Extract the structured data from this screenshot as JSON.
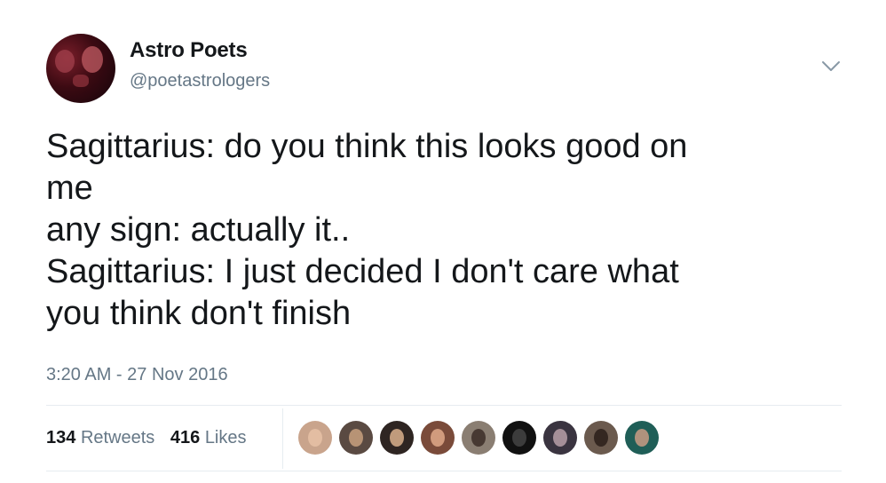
{
  "author": {
    "name": "Astro Poets",
    "handle": "@poetastrologers",
    "avatar_icon": "profile-photo-avatar"
  },
  "menu_icon": "chevron-down-icon",
  "tweet": {
    "lines": [
      "Sagittarius: do you think this looks good on",
      "me",
      "any sign: actually it..",
      "Sagittarius: I just decided I don't care what",
      "you think don't finish"
    ],
    "timestamp": "3:20 AM - 27 Nov 2016"
  },
  "stats": {
    "retweets_count": "134",
    "retweets_label": "Retweets",
    "likes_count": "416",
    "likes_label": "Likes"
  },
  "likers": [
    {
      "bg": "#c9a48c",
      "face": "#e8c2a6"
    },
    {
      "bg": "#5a4a42",
      "face": "#c8a07e"
    },
    {
      "bg": "#2e2522",
      "face": "#d9b08c"
    },
    {
      "bg": "#7a4b3a",
      "face": "#e0a989"
    },
    {
      "bg": "#8a7e72",
      "face": "#3b2d27"
    },
    {
      "bg": "#111111",
      "face": "#444444"
    },
    {
      "bg": "#3a3440",
      "face": "#b9a0a8"
    },
    {
      "bg": "#6b5a4e",
      "face": "#2a1e1a"
    },
    {
      "bg": "#1f5e57",
      "face": "#c99b84"
    }
  ],
  "colors": {
    "text_primary": "#14171a",
    "text_secondary": "#657786",
    "divider": "#e6ecf0"
  }
}
